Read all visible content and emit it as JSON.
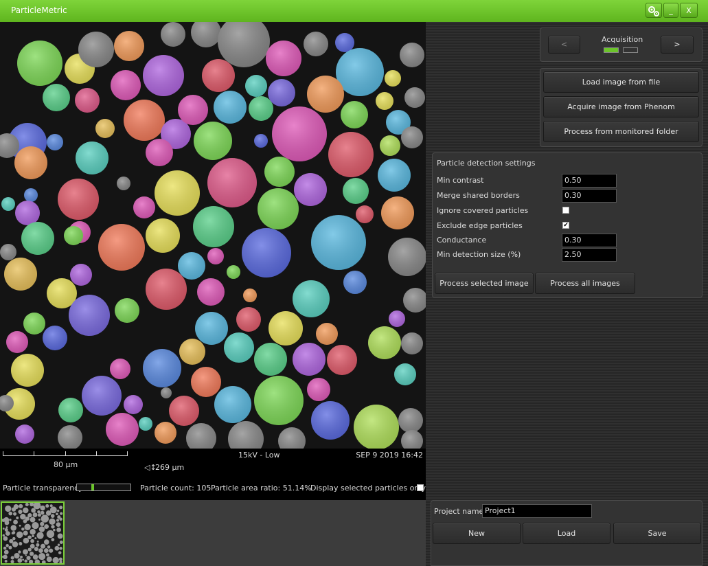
{
  "window": {
    "title": "ParticleMetric",
    "minimize_label": "_",
    "close_label": "X"
  },
  "image_footer": {
    "scale_label": "80 µm",
    "field_width": "269 µm",
    "beam": "15kV - Low",
    "timestamp": "SEP 9 2019 16:42"
  },
  "info_bar": {
    "transparency_label": "Particle transparency",
    "transparency_value": 0.28,
    "particle_count": "Particle count: 105",
    "area_ratio": "Particle area ratio: 51.14%",
    "display_selected_label": "Display selected particles only"
  },
  "acquisition": {
    "title": "Acquisition",
    "prev_label": "<",
    "next_label": ">"
  },
  "load_buttons": {
    "load_file": "Load image from file",
    "acquire_phenom": "Acquire image from Phenom",
    "process_folder": "Process from monitored folder"
  },
  "detection": {
    "title": "Particle detection settings",
    "min_contrast_label": "Min contrast",
    "min_contrast_value": "0.50",
    "merge_label": "Merge shared borders",
    "merge_value": "0.30",
    "ignore_covered_label": "Ignore covered particles",
    "ignore_covered_checked": false,
    "exclude_edge_label": "Exclude edge particles",
    "exclude_edge_checked": true,
    "conductance_label": "Conductance",
    "conductance_value": "0.30",
    "min_size_label": "Min detection size (%)",
    "min_size_value": "2.50",
    "process_selected": "Process selected image",
    "process_all": "Process all images"
  },
  "project": {
    "name_label": "Project name",
    "name_value": "Project1",
    "new_label": "New",
    "load_label": "Load",
    "save_label": "Save"
  },
  "colors": {
    "accent": "#6cc52b",
    "panel": "#333333"
  }
}
